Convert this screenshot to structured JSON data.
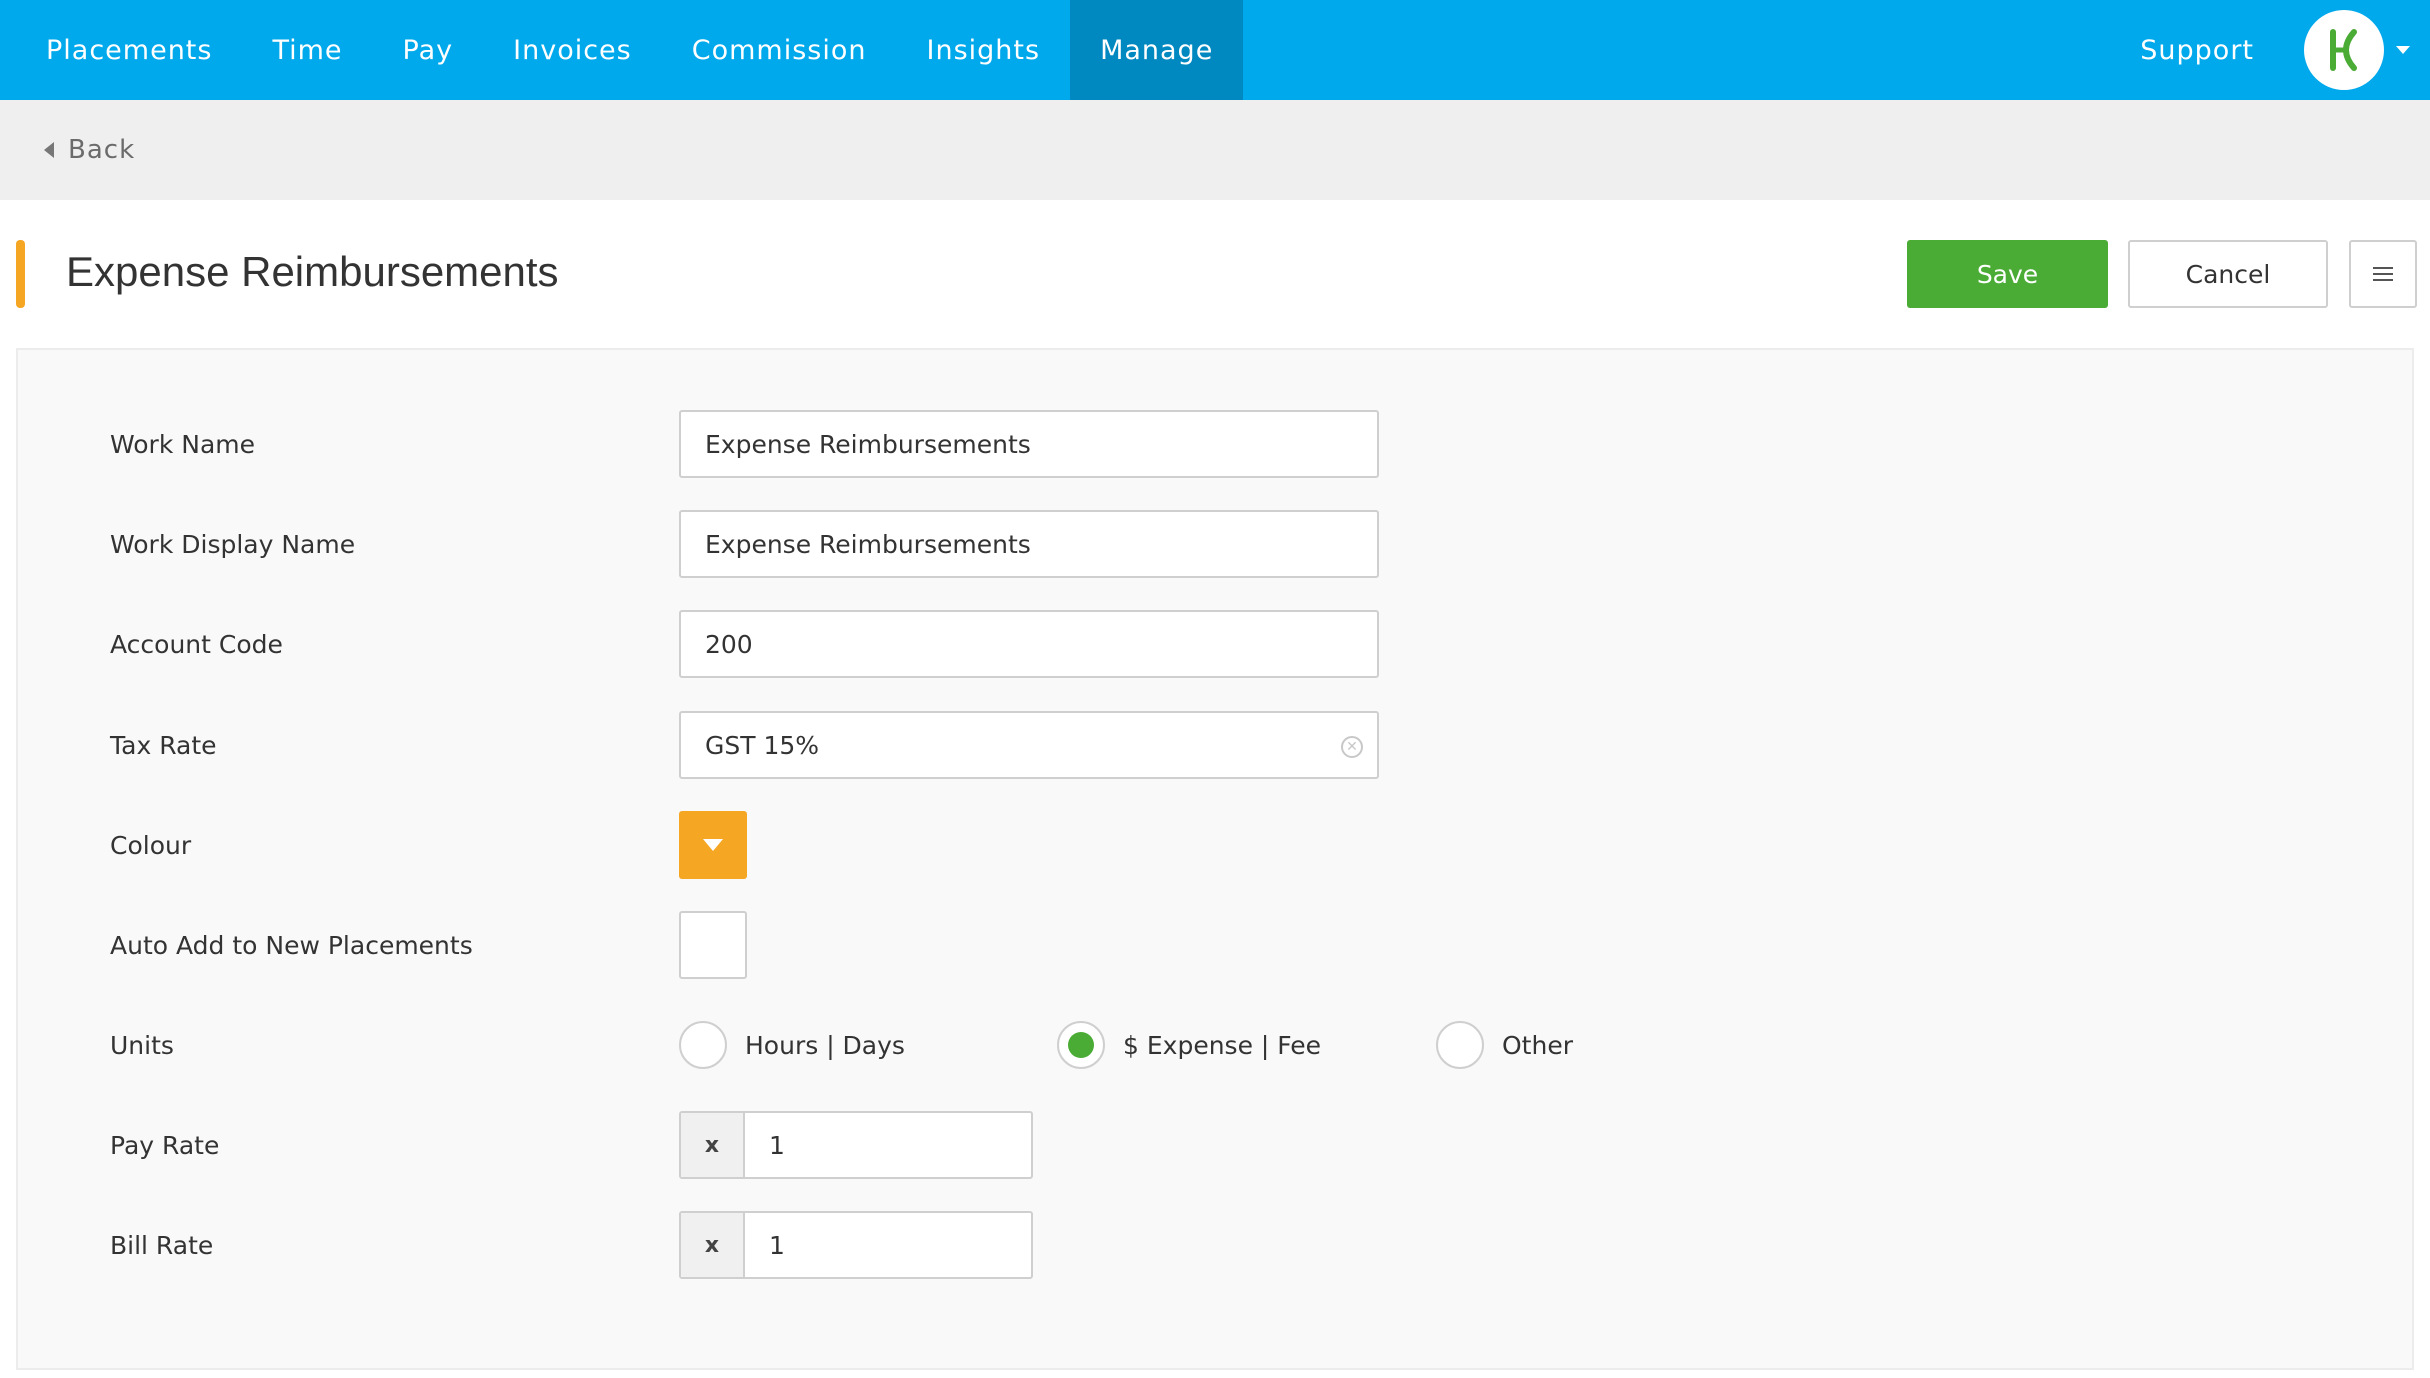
{
  "nav": {
    "items": [
      "Placements",
      "Time",
      "Pay",
      "Invoices",
      "Commission",
      "Insights",
      "Manage"
    ],
    "active": "Manage",
    "support_label": "Support",
    "avatar_icon": "k-logo-icon",
    "brand_color": "#00a9ec"
  },
  "backbar": {
    "label": "Back"
  },
  "header": {
    "title": "Expense Reimbursements",
    "accent_color": "#f5a623",
    "save_label": "Save",
    "cancel_label": "Cancel",
    "menu_icon": "hamburger-icon"
  },
  "form": {
    "work_name": {
      "label": "Work Name",
      "value": "Expense Reimbursements"
    },
    "work_display_name": {
      "label": "Work Display Name",
      "value": "Expense Reimbursements"
    },
    "account_code": {
      "label": "Account Code",
      "value": "200"
    },
    "tax_rate": {
      "label": "Tax Rate",
      "value": "GST 15%"
    },
    "colour": {
      "label": "Colour",
      "value": "#f5a623"
    },
    "auto_add": {
      "label": "Auto Add to New Placements",
      "checked": false
    },
    "units": {
      "label": "Units",
      "options": [
        "Hours | Days",
        "$ Expense | Fee",
        "Other"
      ],
      "selected": "$ Expense | Fee"
    },
    "pay_rate": {
      "label": "Pay Rate",
      "prefix": "x",
      "value": "1"
    },
    "bill_rate": {
      "label": "Bill Rate",
      "prefix": "x",
      "value": "1"
    }
  }
}
